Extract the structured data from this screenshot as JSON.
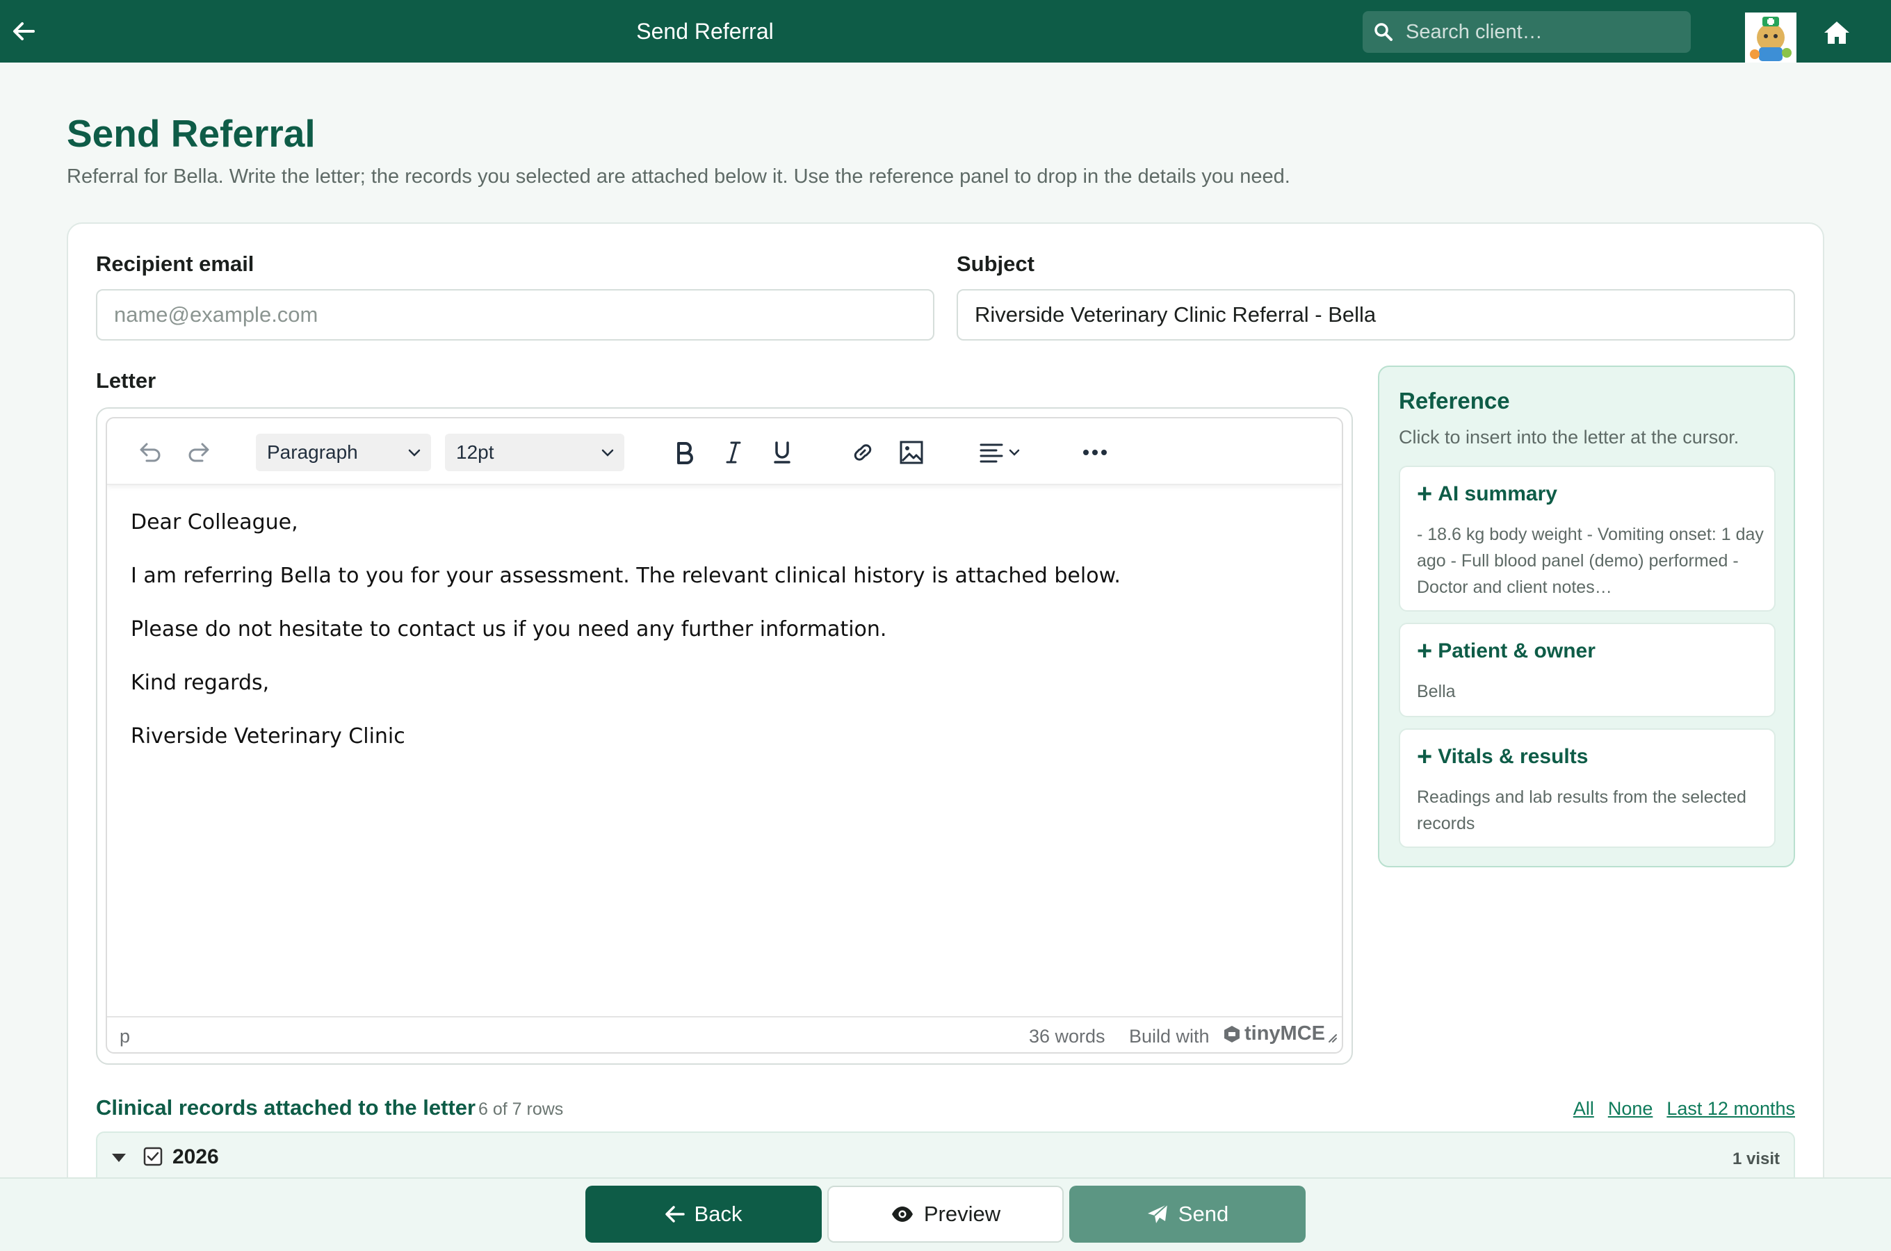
{
  "topbar": {
    "title": "Send Referral",
    "search_placeholder": "Search client…"
  },
  "page": {
    "title": "Send Referral",
    "subtitle": "Referral for Bella. Write the letter; the records you selected are attached below it. Use the reference panel to drop in the details you need."
  },
  "form": {
    "recipient_label": "Recipient email",
    "recipient_placeholder": "name@example.com",
    "subject_label": "Subject",
    "subject_value": "Riverside Veterinary Clinic Referral - Bella",
    "letter_label": "Letter"
  },
  "editor": {
    "block_format": "Paragraph",
    "font_size": "12pt",
    "paragraphs": [
      "Dear Colleague,",
      "I am referring Bella to you for your assessment. The relevant clinical history is attached below.",
      "Please do not hesitate to contact us if you need any further information.",
      "Kind regards,",
      "Riverside Veterinary Clinic"
    ],
    "status_path": "p",
    "word_count": "36 words",
    "branding": "Build with",
    "brand_name": "tinyMCE"
  },
  "reference": {
    "title": "Reference",
    "hint": "Click to insert into the letter at the cursor.",
    "items": [
      {
        "title": "AI summary",
        "body": "- 18.6 kg body weight - Vomiting onset: 1 day ago - Full blood panel (demo) performed - Doctor and client notes…"
      },
      {
        "title": "Patient & owner",
        "body": "Bella"
      },
      {
        "title": "Vitals & results",
        "body": "Readings and lab results from the selected records"
      }
    ]
  },
  "records": {
    "title": "Clinical records attached to the letter",
    "count": "6 of 7 rows",
    "links": [
      "All",
      "None",
      "Last 12 months"
    ],
    "groups": [
      {
        "year": "2026",
        "visits": "1 visit",
        "checked": true,
        "expanded": true
      }
    ]
  },
  "actions": {
    "back": "Back",
    "preview": "Preview",
    "send": "Send"
  },
  "colors": {
    "brand": "#0e5c47",
    "send_button": "#5c9683",
    "reference_bg": "#e8f6f0"
  },
  "icons": [
    "back-arrow-icon",
    "search-icon",
    "home-icon",
    "undo-icon",
    "redo-icon",
    "bold-icon",
    "italic-icon",
    "underline-icon",
    "link-icon",
    "image-icon",
    "align-icon",
    "more-icon",
    "eye-icon",
    "send-icon"
  ]
}
